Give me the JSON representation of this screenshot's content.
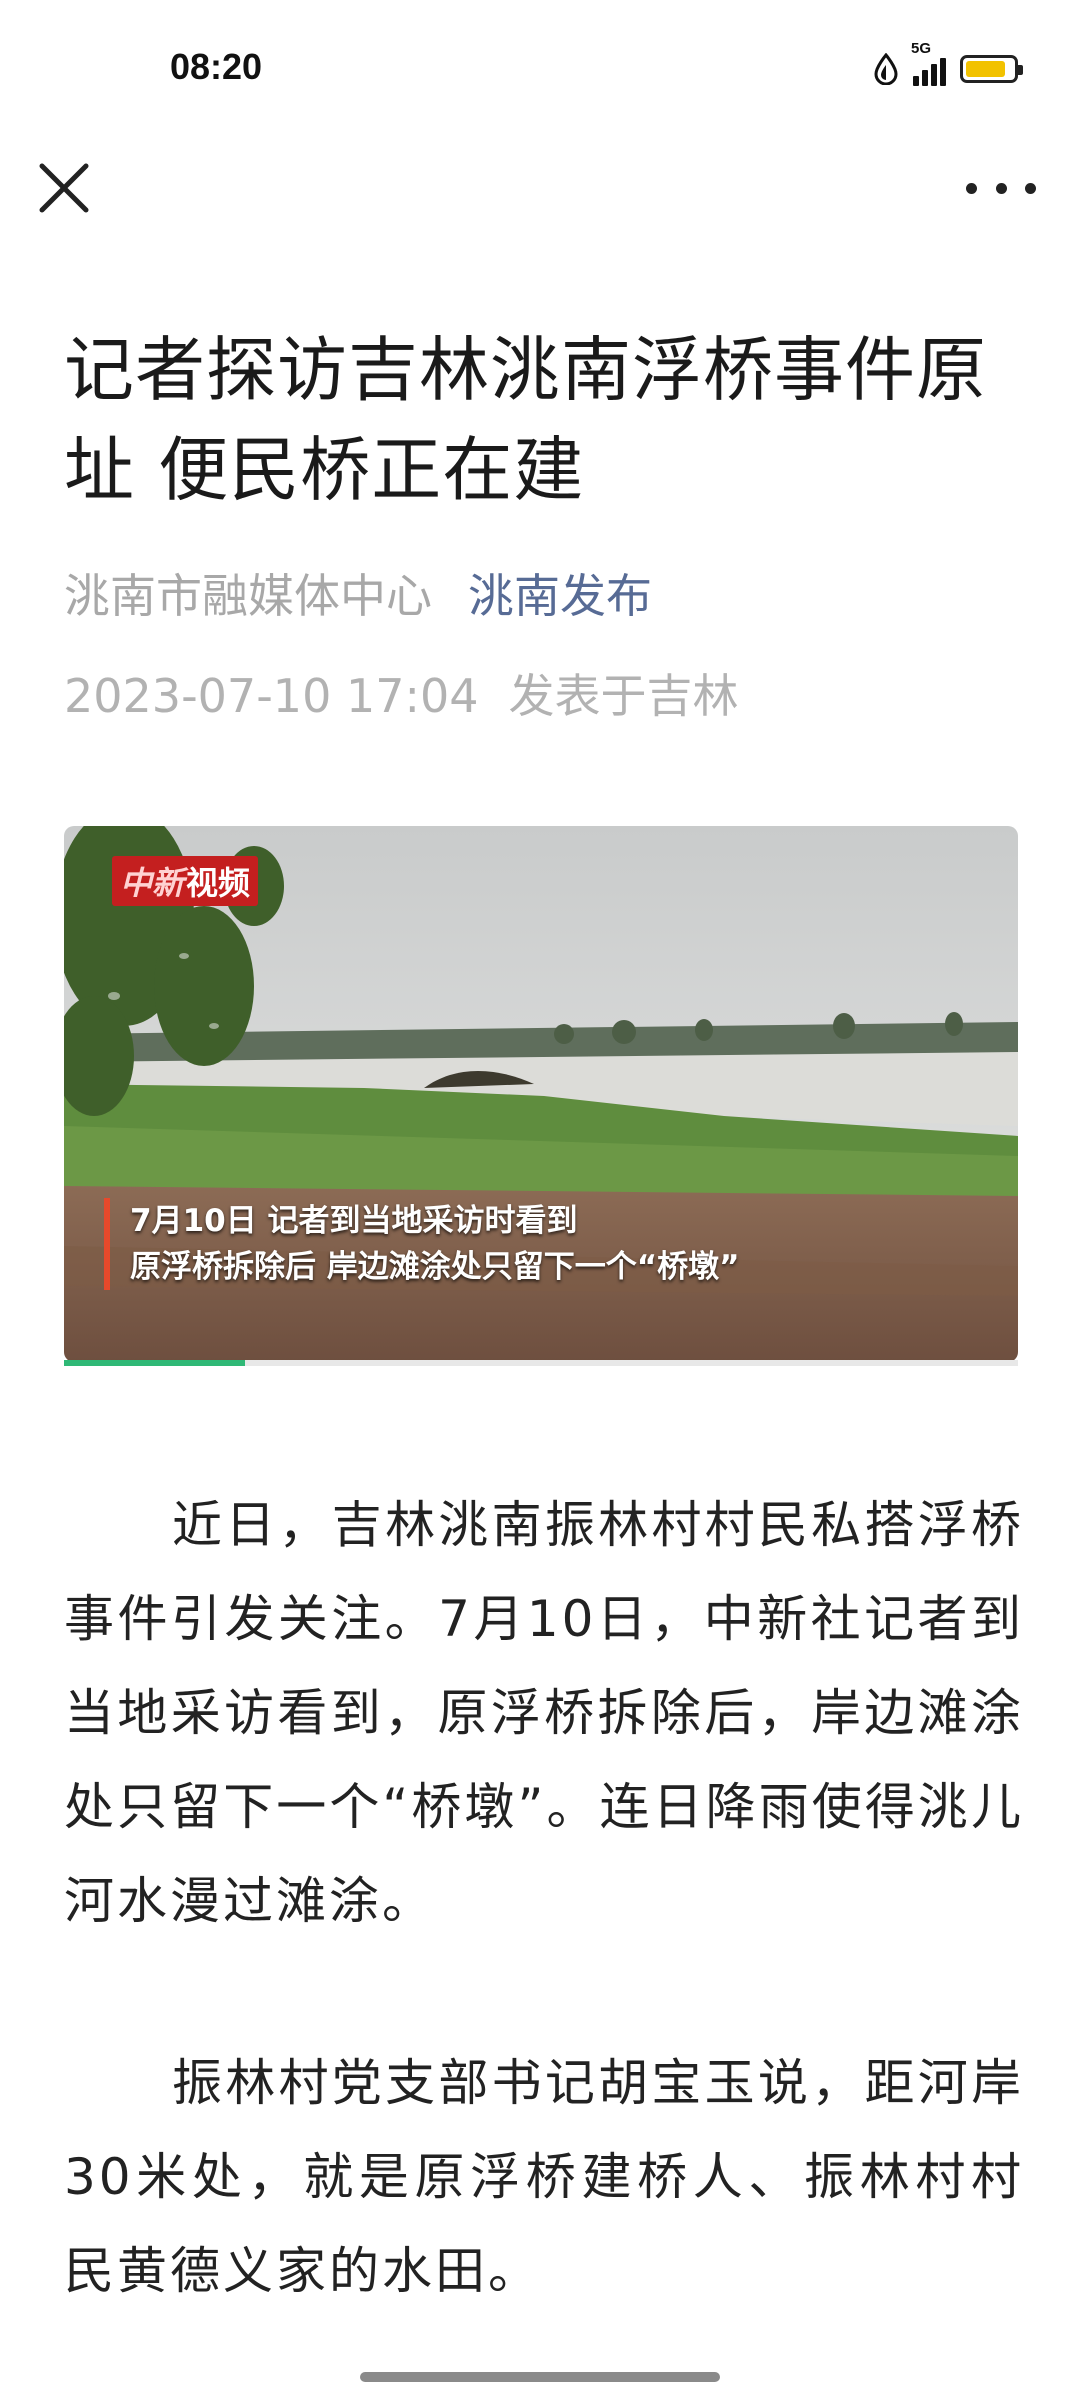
{
  "status_bar": {
    "time": "08:20",
    "network": "5G",
    "battery_level": 0.85,
    "battery_color": "#f2c200"
  },
  "topbar": {
    "close_icon": "close-icon",
    "more_icon": "more-dots-icon"
  },
  "article": {
    "title": "记者探访吉林洮南浮桥事件原址 便民桥正在建",
    "source": "洮南市融媒体中心",
    "account": "洮南发布",
    "date": "2023-07-10 17:04",
    "location": "发表于吉林",
    "account_color": "#576b95"
  },
  "video": {
    "logo_a": "中新",
    "logo_b": "视频",
    "caption_line1": "7月10日 记者到当地采访时看到",
    "caption_line2": "原浮桥拆除后 岸边滩涂处只留下一个“桥墩”",
    "progress": 0.19,
    "progress_color": "#2fb876"
  },
  "paragraphs": [
    "近日，吉林洮南振林村村民私搭浮桥事件引发关注。7月10日，中新社记者到当地采访看到，原浮桥拆除后，岸边滩涂处只留下一个“桥墩”。连日降雨使得洮儿河水漫过滩涂。",
    "振林村党支部书记胡宝玉说，距河岸30米处，就是原浮桥建桥人、振林村村民黄德义家的水田。"
  ]
}
